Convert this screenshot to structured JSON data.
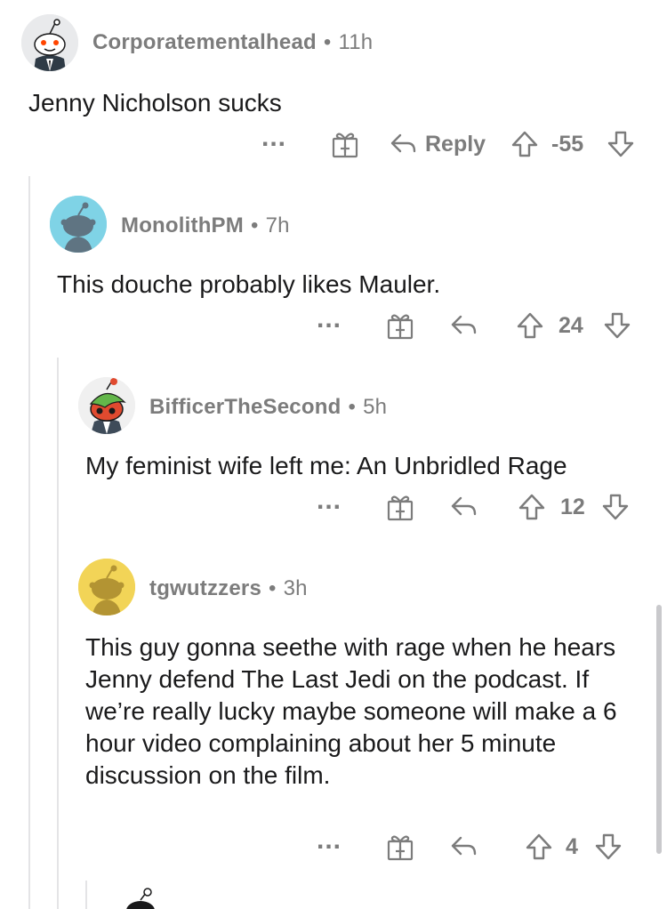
{
  "comments": [
    {
      "username": "Corporatementalhead",
      "age": "11h",
      "body": "Jenny Nicholson sucks",
      "reply_label": "Reply",
      "score": "-55",
      "more": "..."
    },
    {
      "username": "MonolithPM",
      "age": "7h",
      "body": "This douche probably likes Mauler.",
      "score": "24",
      "more": "..."
    },
    {
      "username": "BifficerTheSecond",
      "age": "5h",
      "body": "My feminist wife left me: An Unbridled Rage",
      "score": "12",
      "more": "..."
    },
    {
      "username": "tgwutzzers",
      "age": "3h",
      "body": "This guy gonna seethe with rage when he hears Jenny defend The Last Jedi on the podcast. If we’re really lucky maybe someone will make a 6 hour video complaining about her 5 minute discussion on the film.",
      "score": "4",
      "more": "..."
    }
  ],
  "separator": "•",
  "colors": {
    "avatar_1_bg": "#e9eaec",
    "avatar_2_bg": "#7fd3e6",
    "avatar_3_bg": "#f0f0f0",
    "avatar_4_bg": "#f2d457",
    "text": "#1a1a1b",
    "meta": "#7c7c7c"
  },
  "icons": [
    "snoo-avatar-icon",
    "award-gift-icon",
    "reply-arrow-icon",
    "upvote-icon",
    "downvote-icon"
  ]
}
